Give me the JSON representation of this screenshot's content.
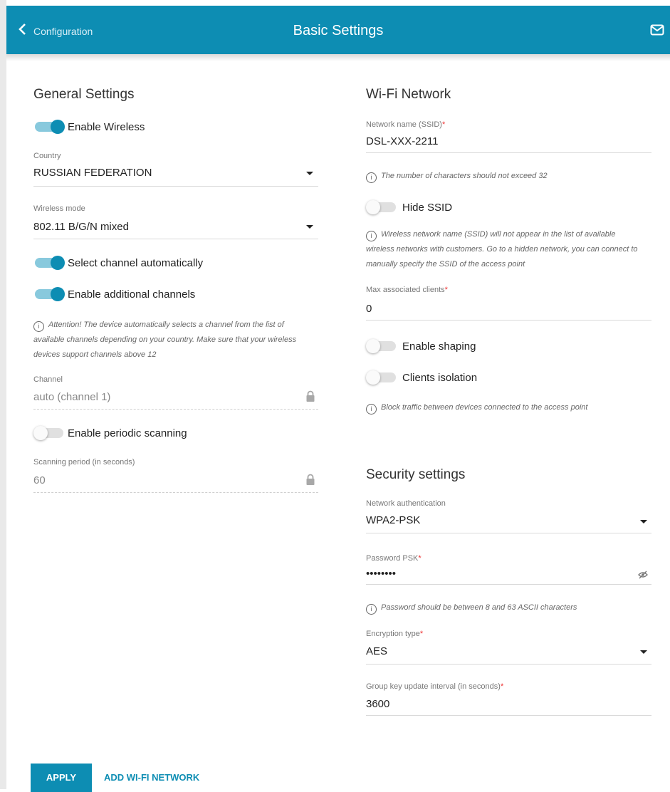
{
  "header": {
    "back_label": "Configuration",
    "title": "Basic Settings",
    "accent": "#0d8db3"
  },
  "general": {
    "title": "General Settings",
    "enable_wireless": {
      "label": "Enable Wireless",
      "on": true
    },
    "country": {
      "label": "Country",
      "value": "RUSSIAN FEDERATION"
    },
    "wireless_mode": {
      "label": "Wireless mode",
      "value": "802.11 B/G/N mixed"
    },
    "select_channel_auto": {
      "label": "Select channel automatically",
      "on": true
    },
    "enable_additional_channels": {
      "label": "Enable additional channels",
      "on": true
    },
    "attention_note": [
      "Attention! The device automatically selects a channel from the list of",
      "available channels depending on your country. Make sure that your wireless",
      "devices support channels above 12"
    ],
    "channel": {
      "label": "Channel",
      "value": "auto (channel 1)"
    },
    "enable_periodic_scanning": {
      "label": "Enable periodic scanning",
      "on": false
    },
    "scanning_period": {
      "label": "Scanning period (in seconds)",
      "value": "60"
    }
  },
  "wifi": {
    "title": "Wi-Fi Network",
    "ssid": {
      "label": "Network name (SSID)",
      "value": "DSL-XXX-2211"
    },
    "ssid_note": "The number of characters should not exceed 32",
    "hide_ssid": {
      "label": "Hide SSID",
      "on": false
    },
    "hide_ssid_note": [
      "Wireless network name (SSID) will not appear in the list of available",
      "wireless networks with customers. Go to a hidden network, you can connect to",
      "manually specify the SSID of the access point"
    ],
    "max_clients": {
      "label": "Max associated clients",
      "value": "0"
    },
    "enable_shaping": {
      "label": "Enable shaping",
      "on": false
    },
    "clients_isolation": {
      "label": "Clients isolation",
      "on": false
    },
    "isolation_note": "Block traffic between devices connected to the access point"
  },
  "security": {
    "title": "Security settings",
    "network_auth": {
      "label": "Network authentication",
      "value": "WPA2-PSK"
    },
    "password": {
      "label": "Password PSK",
      "value": "••••••••"
    },
    "password_note": "Password should be between 8 and 63 ASCII characters",
    "encryption": {
      "label": "Encryption type",
      "value": "AES"
    },
    "group_key": {
      "label": "Group key update interval (in seconds)",
      "value": "3600"
    }
  },
  "actions": {
    "apply": "APPLY",
    "add_wifi": "ADD WI-FI NETWORK"
  },
  "required_mark": "*"
}
